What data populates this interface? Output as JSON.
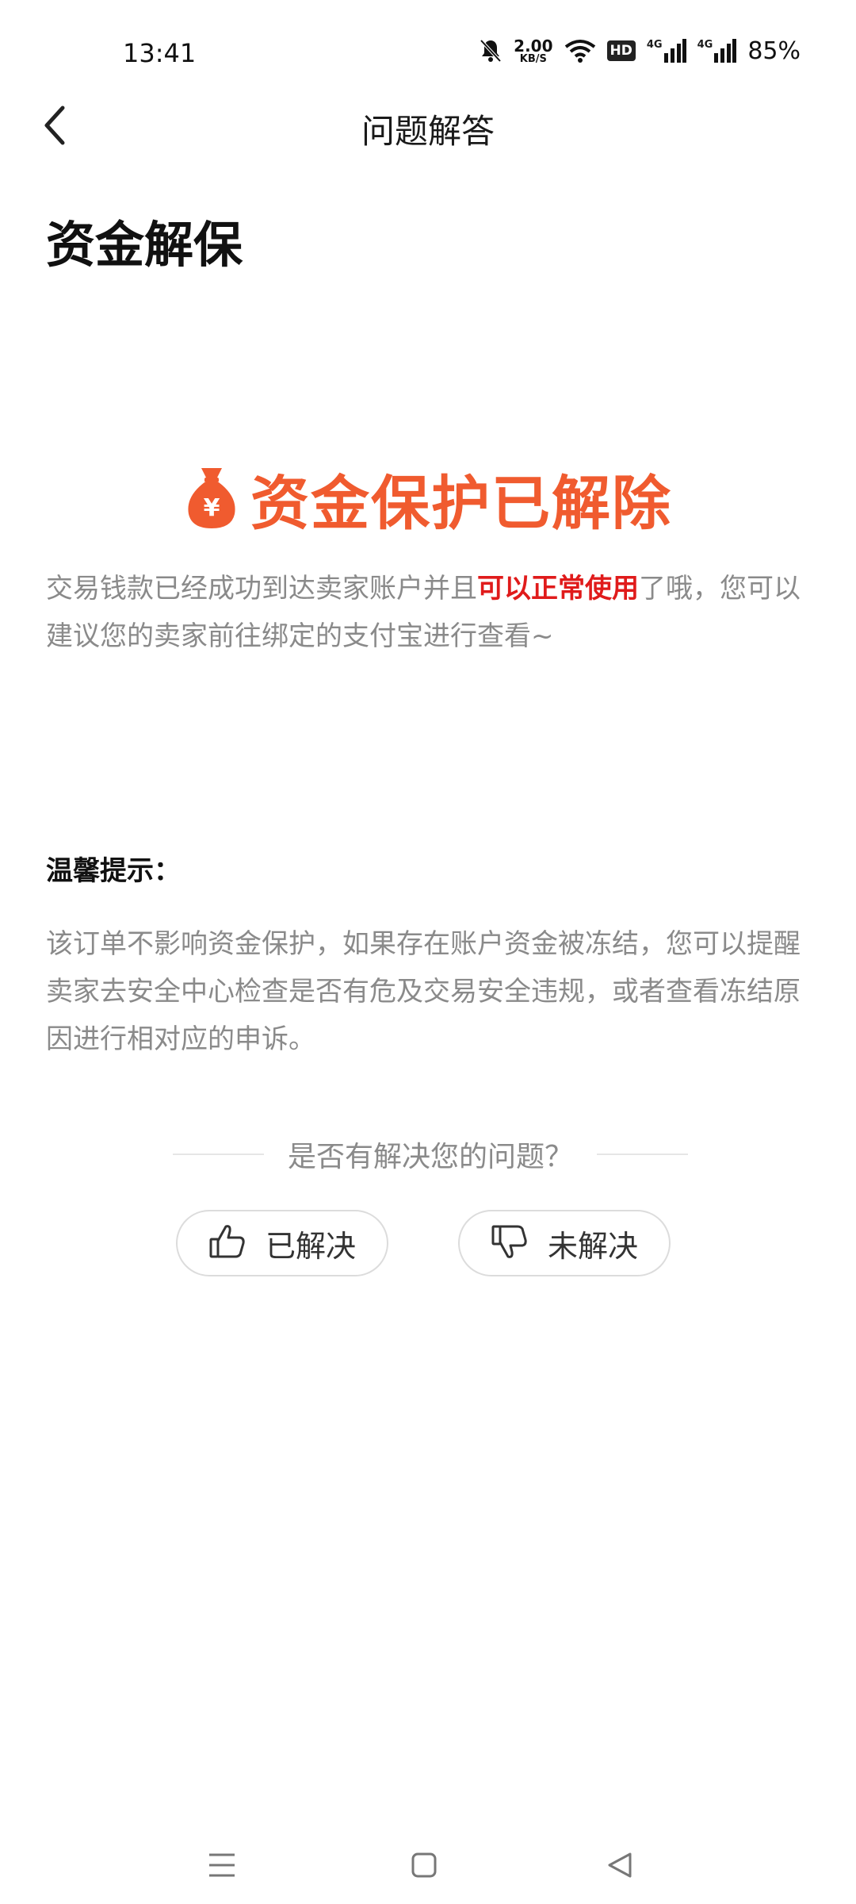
{
  "status_bar": {
    "time": "13:41",
    "net_speed_value": "2.00",
    "net_speed_unit": "KB/S",
    "hd_badge": "HD",
    "signal_1_label": "4G",
    "signal_2_label": "4G",
    "battery": "85%"
  },
  "header": {
    "title": "问题解答",
    "back_icon": "chevron-left-icon"
  },
  "page_title": "资金解保",
  "hero": {
    "icon": "money-bag-icon",
    "text": "资金保护已解除",
    "accent_color": "#f05b2f"
  },
  "answer": {
    "before": "交易钱款已经成功到达卖家账户并且",
    "highlight": "可以正常使用",
    "after": "了哦，您可以建议您的卖家前往绑定的支付宝进行查看~",
    "highlight_color": "#e01b1b"
  },
  "tip": {
    "title": "温馨提示：",
    "text": "该订单不影响资金保护，如果存在账户资金被冻结，您可以提醒卖家去安全中心检查是否有危及交易安全违规，或者查看冻结原因进行相对应的申诉。"
  },
  "feedback": {
    "question": "是否有解决您的问题？",
    "resolved_label": "已解决",
    "resolved_icon": "thumbs-up-icon",
    "unresolved_label": "未解决",
    "unresolved_icon": "thumbs-down-icon"
  },
  "system_nav": {
    "menu_icon": "menu-icon",
    "home_icon": "home-square-icon",
    "back_icon": "back-triangle-icon"
  }
}
